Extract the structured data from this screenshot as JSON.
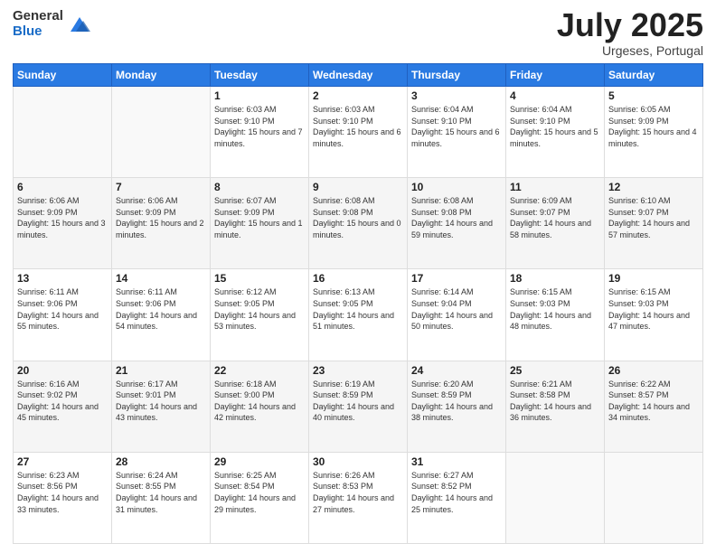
{
  "header": {
    "logo_general": "General",
    "logo_blue": "Blue",
    "title": "July 2025",
    "location": "Urgeses, Portugal"
  },
  "days_of_week": [
    "Sunday",
    "Monday",
    "Tuesday",
    "Wednesday",
    "Thursday",
    "Friday",
    "Saturday"
  ],
  "weeks": [
    [
      {
        "day": "",
        "sunrise": "",
        "sunset": "",
        "daylight": ""
      },
      {
        "day": "",
        "sunrise": "",
        "sunset": "",
        "daylight": ""
      },
      {
        "day": "1",
        "sunrise": "Sunrise: 6:03 AM",
        "sunset": "Sunset: 9:10 PM",
        "daylight": "Daylight: 15 hours and 7 minutes."
      },
      {
        "day": "2",
        "sunrise": "Sunrise: 6:03 AM",
        "sunset": "Sunset: 9:10 PM",
        "daylight": "Daylight: 15 hours and 6 minutes."
      },
      {
        "day": "3",
        "sunrise": "Sunrise: 6:04 AM",
        "sunset": "Sunset: 9:10 PM",
        "daylight": "Daylight: 15 hours and 6 minutes."
      },
      {
        "day": "4",
        "sunrise": "Sunrise: 6:04 AM",
        "sunset": "Sunset: 9:10 PM",
        "daylight": "Daylight: 15 hours and 5 minutes."
      },
      {
        "day": "5",
        "sunrise": "Sunrise: 6:05 AM",
        "sunset": "Sunset: 9:09 PM",
        "daylight": "Daylight: 15 hours and 4 minutes."
      }
    ],
    [
      {
        "day": "6",
        "sunrise": "Sunrise: 6:06 AM",
        "sunset": "Sunset: 9:09 PM",
        "daylight": "Daylight: 15 hours and 3 minutes."
      },
      {
        "day": "7",
        "sunrise": "Sunrise: 6:06 AM",
        "sunset": "Sunset: 9:09 PM",
        "daylight": "Daylight: 15 hours and 2 minutes."
      },
      {
        "day": "8",
        "sunrise": "Sunrise: 6:07 AM",
        "sunset": "Sunset: 9:09 PM",
        "daylight": "Daylight: 15 hours and 1 minute."
      },
      {
        "day": "9",
        "sunrise": "Sunrise: 6:08 AM",
        "sunset": "Sunset: 9:08 PM",
        "daylight": "Daylight: 15 hours and 0 minutes."
      },
      {
        "day": "10",
        "sunrise": "Sunrise: 6:08 AM",
        "sunset": "Sunset: 9:08 PM",
        "daylight": "Daylight: 14 hours and 59 minutes."
      },
      {
        "day": "11",
        "sunrise": "Sunrise: 6:09 AM",
        "sunset": "Sunset: 9:07 PM",
        "daylight": "Daylight: 14 hours and 58 minutes."
      },
      {
        "day": "12",
        "sunrise": "Sunrise: 6:10 AM",
        "sunset": "Sunset: 9:07 PM",
        "daylight": "Daylight: 14 hours and 57 minutes."
      }
    ],
    [
      {
        "day": "13",
        "sunrise": "Sunrise: 6:11 AM",
        "sunset": "Sunset: 9:06 PM",
        "daylight": "Daylight: 14 hours and 55 minutes."
      },
      {
        "day": "14",
        "sunrise": "Sunrise: 6:11 AM",
        "sunset": "Sunset: 9:06 PM",
        "daylight": "Daylight: 14 hours and 54 minutes."
      },
      {
        "day": "15",
        "sunrise": "Sunrise: 6:12 AM",
        "sunset": "Sunset: 9:05 PM",
        "daylight": "Daylight: 14 hours and 53 minutes."
      },
      {
        "day": "16",
        "sunrise": "Sunrise: 6:13 AM",
        "sunset": "Sunset: 9:05 PM",
        "daylight": "Daylight: 14 hours and 51 minutes."
      },
      {
        "day": "17",
        "sunrise": "Sunrise: 6:14 AM",
        "sunset": "Sunset: 9:04 PM",
        "daylight": "Daylight: 14 hours and 50 minutes."
      },
      {
        "day": "18",
        "sunrise": "Sunrise: 6:15 AM",
        "sunset": "Sunset: 9:03 PM",
        "daylight": "Daylight: 14 hours and 48 minutes."
      },
      {
        "day": "19",
        "sunrise": "Sunrise: 6:15 AM",
        "sunset": "Sunset: 9:03 PM",
        "daylight": "Daylight: 14 hours and 47 minutes."
      }
    ],
    [
      {
        "day": "20",
        "sunrise": "Sunrise: 6:16 AM",
        "sunset": "Sunset: 9:02 PM",
        "daylight": "Daylight: 14 hours and 45 minutes."
      },
      {
        "day": "21",
        "sunrise": "Sunrise: 6:17 AM",
        "sunset": "Sunset: 9:01 PM",
        "daylight": "Daylight: 14 hours and 43 minutes."
      },
      {
        "day": "22",
        "sunrise": "Sunrise: 6:18 AM",
        "sunset": "Sunset: 9:00 PM",
        "daylight": "Daylight: 14 hours and 42 minutes."
      },
      {
        "day": "23",
        "sunrise": "Sunrise: 6:19 AM",
        "sunset": "Sunset: 8:59 PM",
        "daylight": "Daylight: 14 hours and 40 minutes."
      },
      {
        "day": "24",
        "sunrise": "Sunrise: 6:20 AM",
        "sunset": "Sunset: 8:59 PM",
        "daylight": "Daylight: 14 hours and 38 minutes."
      },
      {
        "day": "25",
        "sunrise": "Sunrise: 6:21 AM",
        "sunset": "Sunset: 8:58 PM",
        "daylight": "Daylight: 14 hours and 36 minutes."
      },
      {
        "day": "26",
        "sunrise": "Sunrise: 6:22 AM",
        "sunset": "Sunset: 8:57 PM",
        "daylight": "Daylight: 14 hours and 34 minutes."
      }
    ],
    [
      {
        "day": "27",
        "sunrise": "Sunrise: 6:23 AM",
        "sunset": "Sunset: 8:56 PM",
        "daylight": "Daylight: 14 hours and 33 minutes."
      },
      {
        "day": "28",
        "sunrise": "Sunrise: 6:24 AM",
        "sunset": "Sunset: 8:55 PM",
        "daylight": "Daylight: 14 hours and 31 minutes."
      },
      {
        "day": "29",
        "sunrise": "Sunrise: 6:25 AM",
        "sunset": "Sunset: 8:54 PM",
        "daylight": "Daylight: 14 hours and 29 minutes."
      },
      {
        "day": "30",
        "sunrise": "Sunrise: 6:26 AM",
        "sunset": "Sunset: 8:53 PM",
        "daylight": "Daylight: 14 hours and 27 minutes."
      },
      {
        "day": "31",
        "sunrise": "Sunrise: 6:27 AM",
        "sunset": "Sunset: 8:52 PM",
        "daylight": "Daylight: 14 hours and 25 minutes."
      },
      {
        "day": "",
        "sunrise": "",
        "sunset": "",
        "daylight": ""
      },
      {
        "day": "",
        "sunrise": "",
        "sunset": "",
        "daylight": ""
      }
    ]
  ]
}
